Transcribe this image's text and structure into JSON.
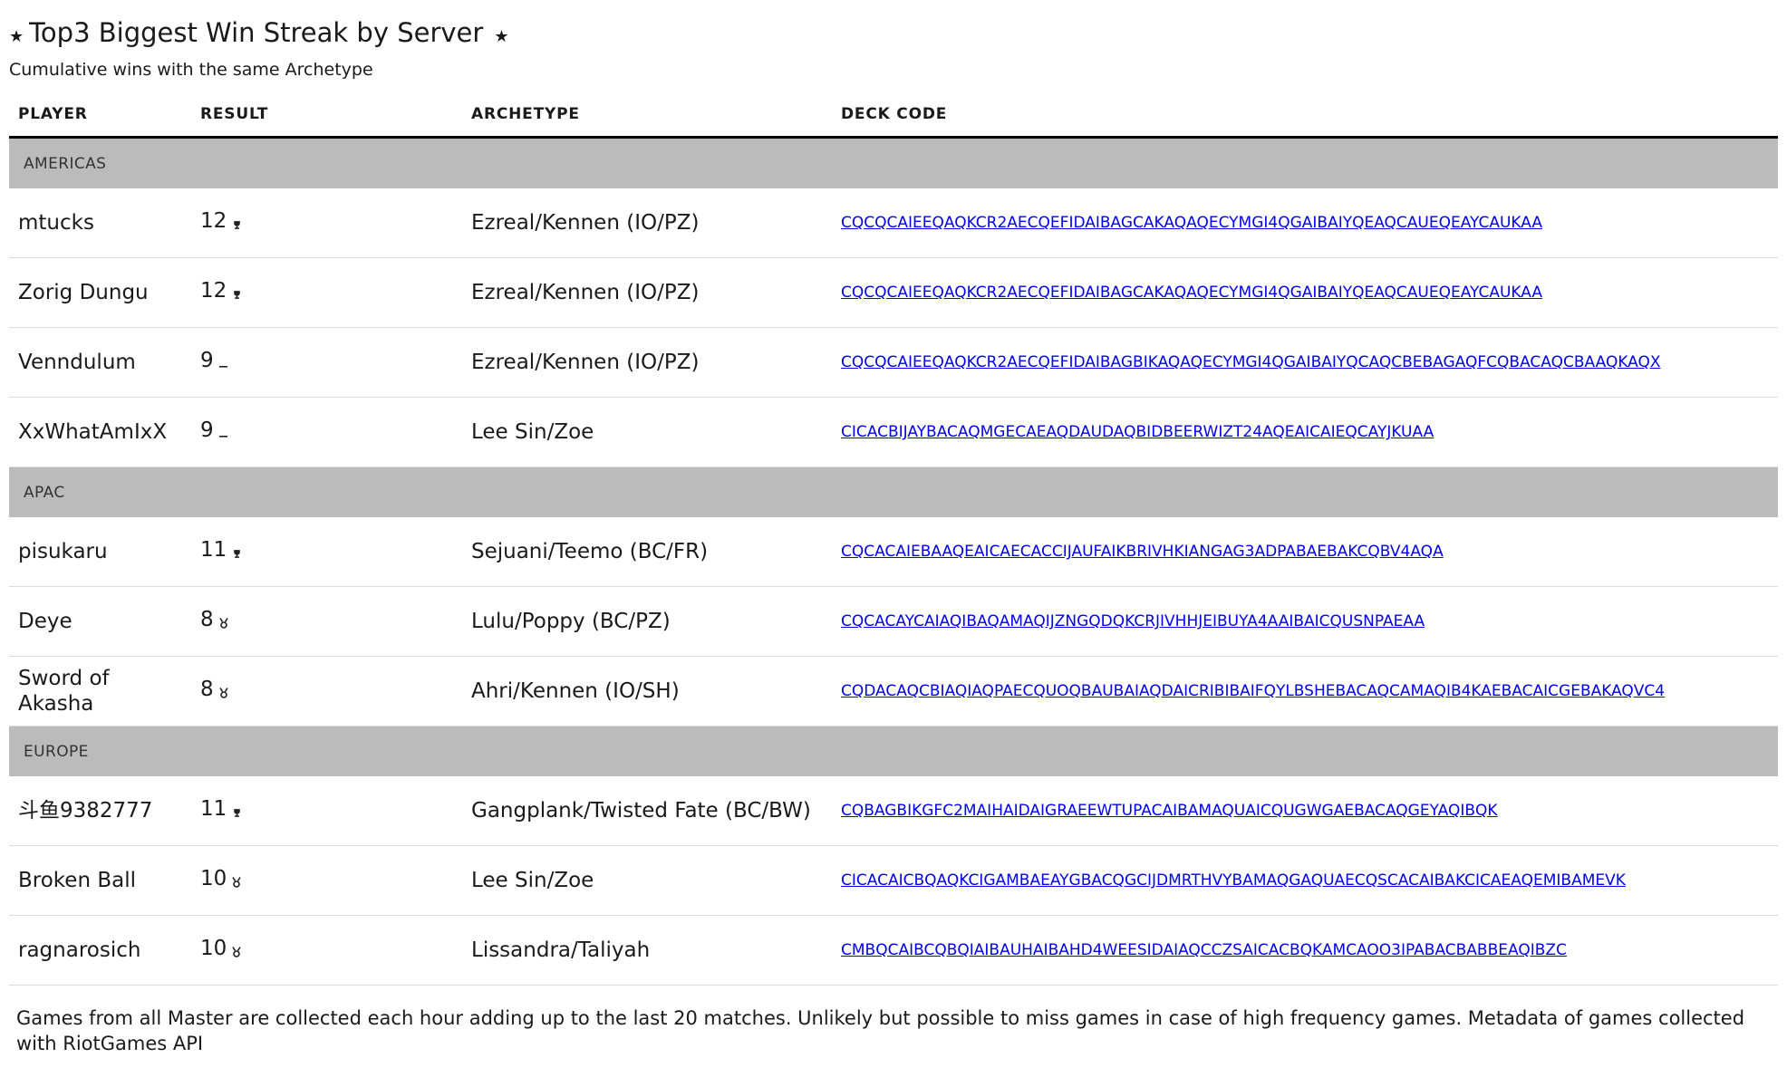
{
  "header": {
    "title": "Top3 Biggest Win Streak by Server",
    "star_glyph": "★",
    "subtitle": "Cumulative wins with the same Archetype"
  },
  "table": {
    "columns": [
      "PLAYER",
      "RESULT",
      "ARCHETYPE",
      "DECK CODE"
    ],
    "groups": [
      {
        "name": "AMERICAS",
        "rows": [
          {
            "player": "mtucks",
            "result": "12",
            "result_icon": "trophy-icon",
            "archetype": "Ezreal/Kennen (IO/PZ)",
            "deck": "CQCQCAIEEQAQKCR2AECQEFIDAIBAGCAKAQAQECYMGI4QGAIBAIYQEAQCAUEQEAYCAUKAA"
          },
          {
            "player": "Zorig Dungu",
            "result": "12",
            "result_icon": "trophy-icon",
            "archetype": "Ezreal/Kennen (IO/PZ)",
            "deck": "CQCQCAIEEQAQKCR2AECQEFIDAIBAGCAKAQAQECYMGI4QGAIBAIYQEAQCAUEQEAYCAUKAA"
          },
          {
            "player": "Venndulum",
            "result": "9",
            "result_icon": "dash-icon",
            "archetype": "Ezreal/Kennen (IO/PZ)",
            "deck": "CQCQCAIEEQAQKCR2AECQEFIDAIBAGBIKAQAQECYMGI4QGAIBAIYQCAQCBEBAGAQFCQBACAQCBAAQKAQX"
          },
          {
            "player": "XxWhatAmIxX",
            "result": "9",
            "result_icon": "dash-icon",
            "archetype": "Lee Sin/Zoe",
            "deck": "CICACBIJAYBACAQMGECAEAQDAUDAQBIDBEERWIZT24AQEAICAIEQCAYJKUAA"
          }
        ]
      },
      {
        "name": "APAC",
        "rows": [
          {
            "player": "pisukaru",
            "result": "11",
            "result_icon": "trophy-icon",
            "archetype": "Sejuani/Teemo (BC/FR)",
            "deck": "CQCACAIEBAAQEAICAECACCIJAUFAIKBRIVHKIANGAG3ADPABAEBAKCQBV4AQA"
          },
          {
            "player": "Deye",
            "result": "8",
            "result_icon": "medal-icon",
            "archetype": "Lulu/Poppy (BC/PZ)",
            "deck": "CQCACAYCAIAQIBAQAMAQIJZNGQDQKCRJIVHHJEIBUYA4AAIBAICQUSNPAEAA"
          },
          {
            "player": "Sword of Akasha",
            "result": "8",
            "result_icon": "medal-icon",
            "archetype": "Ahri/Kennen (IO/SH)",
            "deck": "CQDACAQCBIAQIAQPAECQUOQBAUBAIAQDAICRIBIBAIFQYLBSHEBACAQCAMAQIB4KAEBACAICGEBAKAQVC4"
          }
        ]
      },
      {
        "name": "EUROPE",
        "rows": [
          {
            "player": "斗鱼9382777",
            "result": "11",
            "result_icon": "trophy-icon",
            "archetype": "Gangplank/Twisted Fate (BC/BW)",
            "deck": "CQBAGBIKGFC2MAIHAIDAIGRAEEWTUPACAIBAMAQUAICQUGWGAEBACAQGEYAQIBQK"
          },
          {
            "player": "Broken Ball",
            "result": "10",
            "result_icon": "medal-icon",
            "archetype": "Lee Sin/Zoe",
            "deck": "CICACAICBQAQKCIGAMBAEAYGBACQGCIJDMRTHVYBAMAQGAQUAECQSCACAIBAKCICAEAQEMIBAMEVK"
          },
          {
            "player": "ragnarosich",
            "result": "10",
            "result_icon": "medal-icon",
            "archetype": "Lissandra/Taliyah",
            "deck": "CMBQCAIBCQBQIAIBAUHAIBAHD4WEESIDAIAQCCZSAICACBQKAMCAOO3IPABACBABBEAQIBZC"
          }
        ]
      }
    ]
  },
  "footer": {
    "text": "Games from all Master are collected each hour adding up to the last 20 matches. Unlikely but possible to miss games in case of high frequency games. Metadata of games collected with RiotGames API"
  }
}
